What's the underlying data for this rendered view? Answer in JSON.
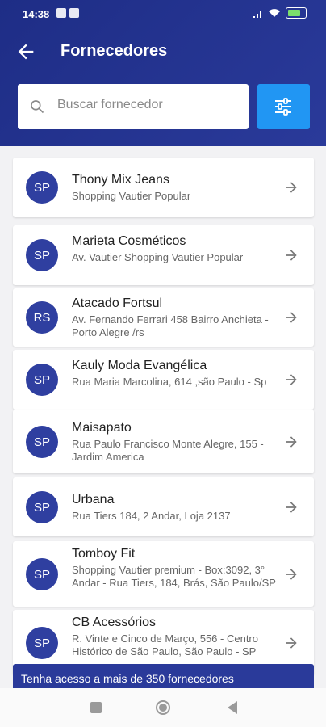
{
  "status": {
    "time": "14:38",
    "battery_percent": 0.75
  },
  "appbar": {
    "title": "Fornecedores"
  },
  "search": {
    "placeholder": "Buscar fornecedor"
  },
  "suppliers": [
    {
      "initials": "SP",
      "name": "Thony Mix Jeans",
      "address": "Shopping Vautier Popular"
    },
    {
      "initials": "SP",
      "name": "Marieta Cosméticos",
      "address": "Av. Vautier  Shopping Vautier Popular"
    },
    {
      "initials": "RS",
      "name": "Atacado Fortsul",
      "address": "Av. Fernando Ferrari 458 Bairro Anchieta - Porto Alegre /rs"
    },
    {
      "initials": "SP",
      "name": "Kauly Moda Evangélica",
      "address": "Rua Maria Marcolina, 614 ,são Paulo - Sp"
    },
    {
      "initials": "SP",
      "name": "Maisapato",
      "address": "Rua Paulo Francisco Monte Alegre, 155 - Jardim America"
    },
    {
      "initials": "SP",
      "name": "Urbana",
      "address": "Rua Tiers 184, 2 Andar, Loja 2137"
    },
    {
      "initials": "SP",
      "name": "Tomboy Fit",
      "address": "Shopping Vautier premium - Box:3092, 3° Andar - Rua Tiers, 184, Brás, São Paulo/SP"
    },
    {
      "initials": "SP",
      "name": "CB Acessórios",
      "address": "R. Vinte e Cinco de Março, 556 - Centro Histórico de São Paulo, São Paulo - SP"
    }
  ],
  "promo": {
    "text": "Tenha acesso a mais de 350 fornecedores"
  },
  "colors": {
    "header": "#1e2d86",
    "accent": "#2196f3",
    "avatar": "#2f3fa0"
  }
}
